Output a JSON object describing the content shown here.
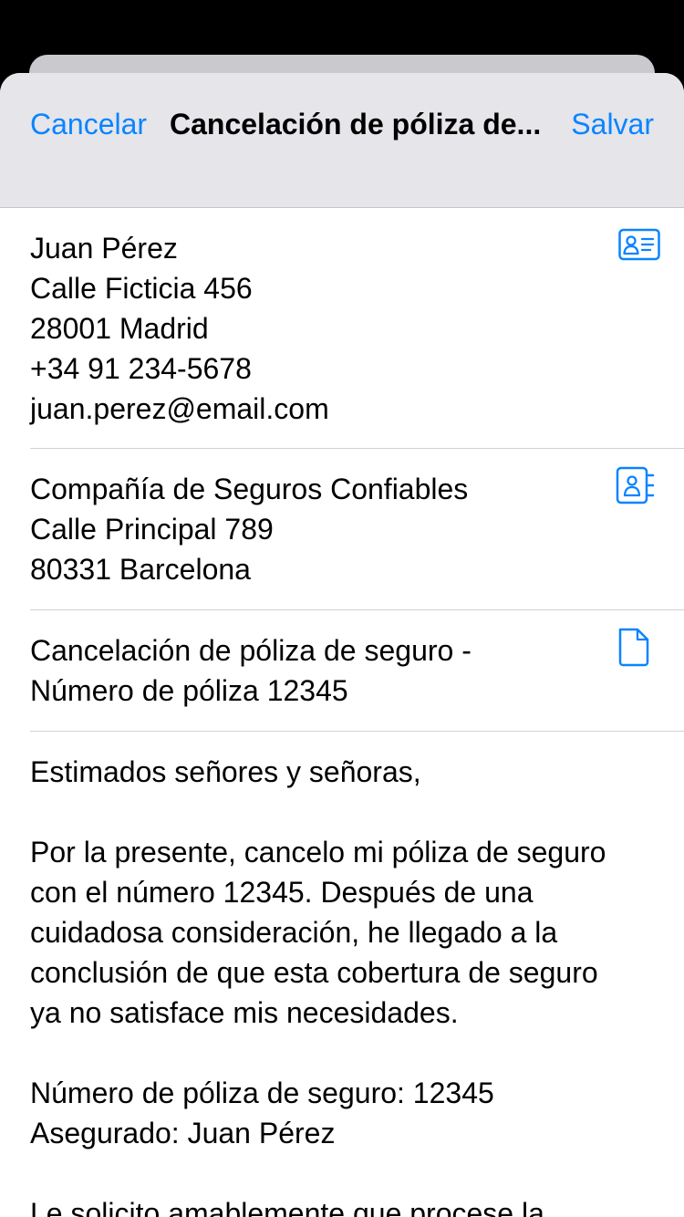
{
  "nav": {
    "cancel_label": "Cancelar",
    "title": "Cancelación de póliza de...",
    "save_label": "Salvar"
  },
  "sender": {
    "lines": [
      "Juan Pérez",
      "Calle Ficticia 456",
      "28001 Madrid",
      "+34 91 234-5678",
      "juan.perez@email.com"
    ],
    "icon": "contact-card-icon"
  },
  "recipient": {
    "lines": [
      "Compañía de Seguros Confiables",
      "Calle Principal 789",
      "80331 Barcelona"
    ],
    "icon": "address-book-icon"
  },
  "subject": {
    "lines": [
      "Cancelación de póliza de seguro -",
      "Número de póliza 12345"
    ],
    "icon": "document-icon"
  },
  "body": {
    "greeting": "Estimados señores y señoras,",
    "paragraph1_lines": [
      "Por la presente, cancelo mi póliza de seguro",
      "con el número 12345. Después de una",
      "cuidadosa consideración, he llegado a la",
      "conclusión de que esta cobertura de seguro",
      "ya no satisface mis necesidades."
    ],
    "policy_number_line": "Número de póliza de seguro: 12345",
    "insured_line": "Asegurado: Juan Pérez",
    "paragraph3_line": "Le solicito amablemente que procese la"
  },
  "colors": {
    "accent": "#0a84ff",
    "nav_background": "#e5e5ea",
    "separator": "#d1d1d6"
  }
}
